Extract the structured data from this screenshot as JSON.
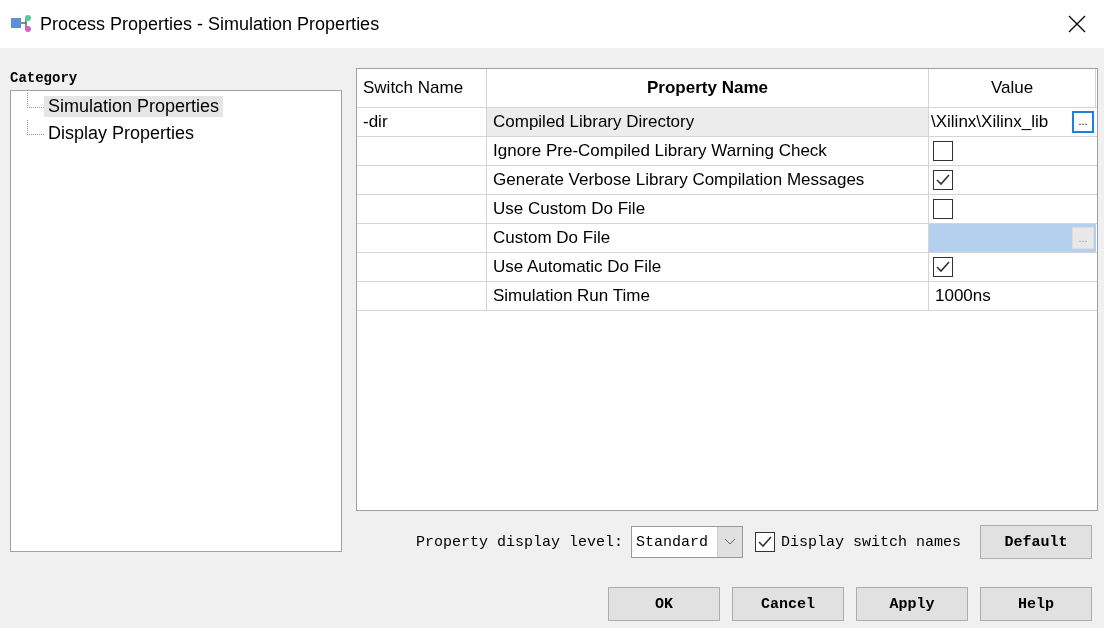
{
  "window": {
    "title": "Process Properties - Simulation Properties"
  },
  "category": {
    "label": "Category",
    "items": [
      {
        "label": "Simulation Properties",
        "selected": true
      },
      {
        "label": "Display Properties",
        "selected": false
      }
    ]
  },
  "table": {
    "columns": [
      "Switch Name",
      "Property Name",
      "Value"
    ],
    "rows": [
      {
        "switch": "-dir",
        "property": "Compiled Library Directory",
        "kind": "browse",
        "value": "\\Xilinx\\Xilinx_lib",
        "button": "...",
        "selected": true,
        "highlighted": false,
        "disabled": false
      },
      {
        "switch": "",
        "property": "Ignore Pre-Compiled Library Warning Check",
        "kind": "checkbox",
        "checked": false,
        "selected": false
      },
      {
        "switch": "",
        "property": "Generate Verbose Library Compilation Messages",
        "kind": "checkbox",
        "checked": true,
        "selected": false
      },
      {
        "switch": "",
        "property": "Use Custom Do File",
        "kind": "checkbox",
        "checked": false,
        "selected": false
      },
      {
        "switch": "",
        "property": "Custom Do File",
        "kind": "browse",
        "button": "...",
        "selected": false,
        "highlighted": true,
        "disabled": true
      },
      {
        "switch": "",
        "property": "Use Automatic Do File",
        "kind": "checkbox",
        "checked": true,
        "selected": false
      },
      {
        "switch": "",
        "property": "Simulation Run Time",
        "kind": "text",
        "value": "1000ns",
        "selected": false
      }
    ]
  },
  "display_level": {
    "label": "Property display level:",
    "value": "Standard"
  },
  "display_switch_names": {
    "label": "Display switch names",
    "checked": true
  },
  "buttons": [
    "Default",
    "OK",
    "Cancel",
    "Apply",
    "Help"
  ]
}
